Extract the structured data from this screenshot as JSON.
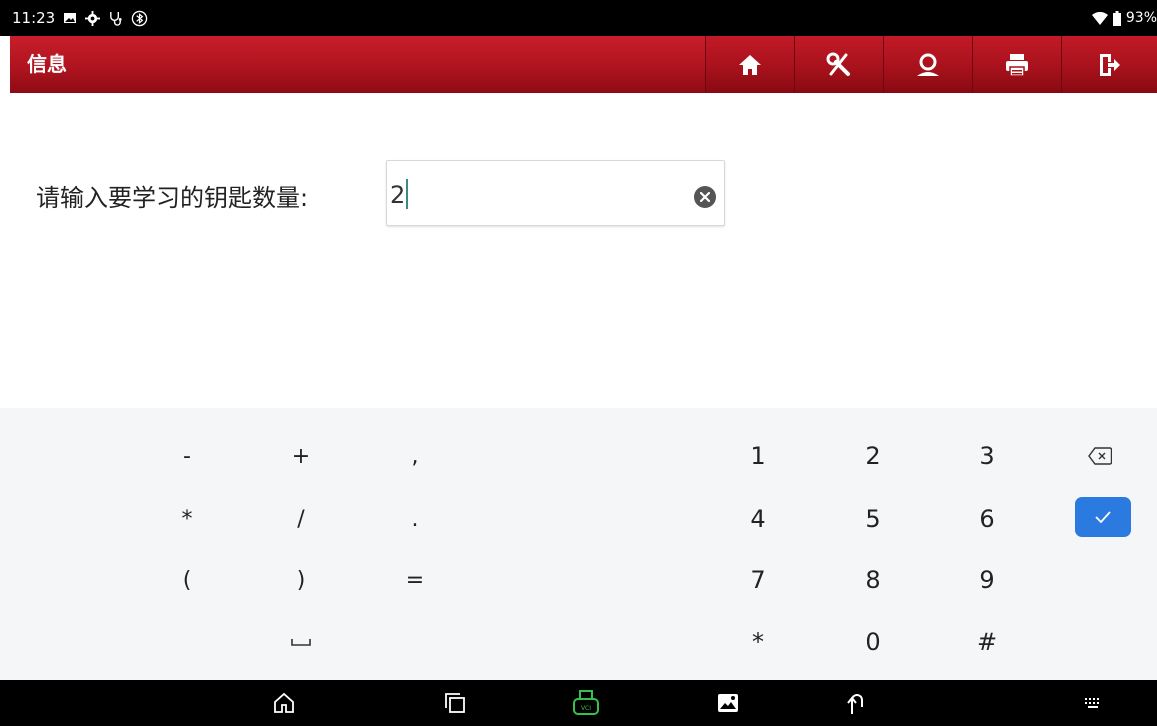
{
  "status_bar": {
    "time": "11:23",
    "battery": "93%",
    "icons": [
      "image-icon",
      "settings-icon",
      "stethoscope-icon",
      "bluetooth-icon",
      "wifi-icon",
      "battery-icon"
    ]
  },
  "header": {
    "title": "信息",
    "buttons": [
      "home-icon",
      "diagnostic-tools-icon",
      "user-profile-icon",
      "print-icon",
      "exit-icon"
    ]
  },
  "form": {
    "label": "请输入要学习的钥匙数量:",
    "value": "2"
  },
  "keyboard": {
    "symbol_keys": [
      "-",
      "+",
      ",",
      "*",
      "/",
      ".",
      "(",
      ")",
      "="
    ],
    "space_key_icon": "space-icon",
    "digit_keys": [
      "1",
      "2",
      "3",
      "4",
      "5",
      "6",
      "7",
      "8",
      "9",
      "*",
      "0",
      "#"
    ],
    "backspace_icon": "backspace-icon",
    "done_icon": "check-icon"
  },
  "nav_bar": {
    "icons": [
      "home-outline-icon",
      "recent-apps-icon",
      "vci-icon",
      "gallery-icon",
      "back-icon",
      "keyboard-icon"
    ]
  },
  "colors": {
    "header_red": "#b0141f",
    "done_blue": "#2b7ae0",
    "vci_green": "#35c24a",
    "caret_teal": "#3a8a86"
  }
}
